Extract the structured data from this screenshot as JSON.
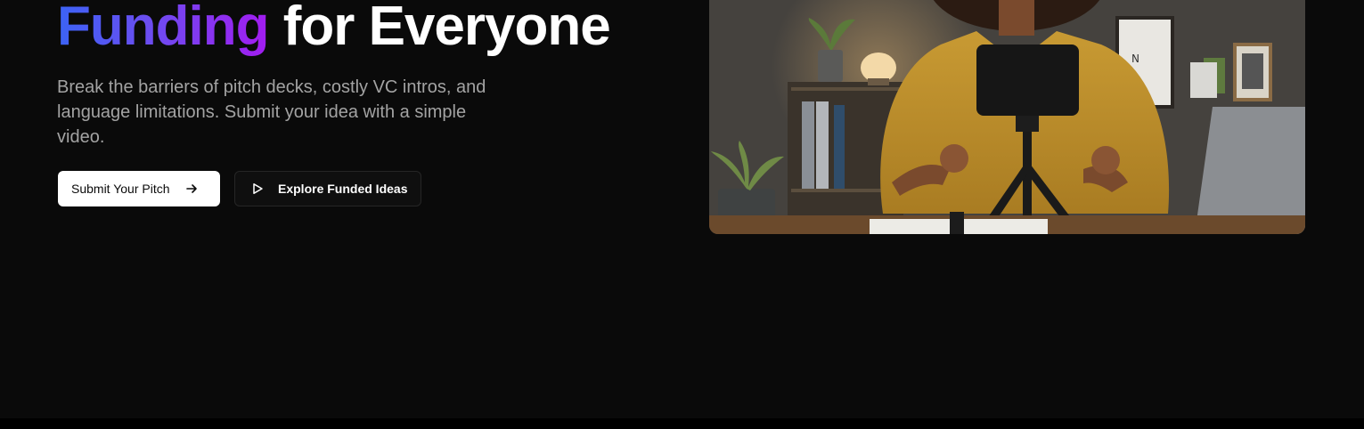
{
  "hero": {
    "title_highlight": "Funding",
    "title_rest": " for Everyone",
    "subtitle": "Break the barriers of pitch decks, costly VC intros, and language limitations. Submit your idea with a simple video.",
    "primary_button": {
      "label": "Submit Your Pitch",
      "icon": "arrow-right-icon"
    },
    "secondary_button": {
      "label": "Explore Funded Ideas",
      "icon": "play-icon"
    },
    "gradient_colors": [
      "#3b63f5",
      "#a21cf0"
    ]
  },
  "colors": {
    "background": "#0a0a0a",
    "primary_button_bg": "#ffffff",
    "secondary_button_border": "#262626"
  }
}
